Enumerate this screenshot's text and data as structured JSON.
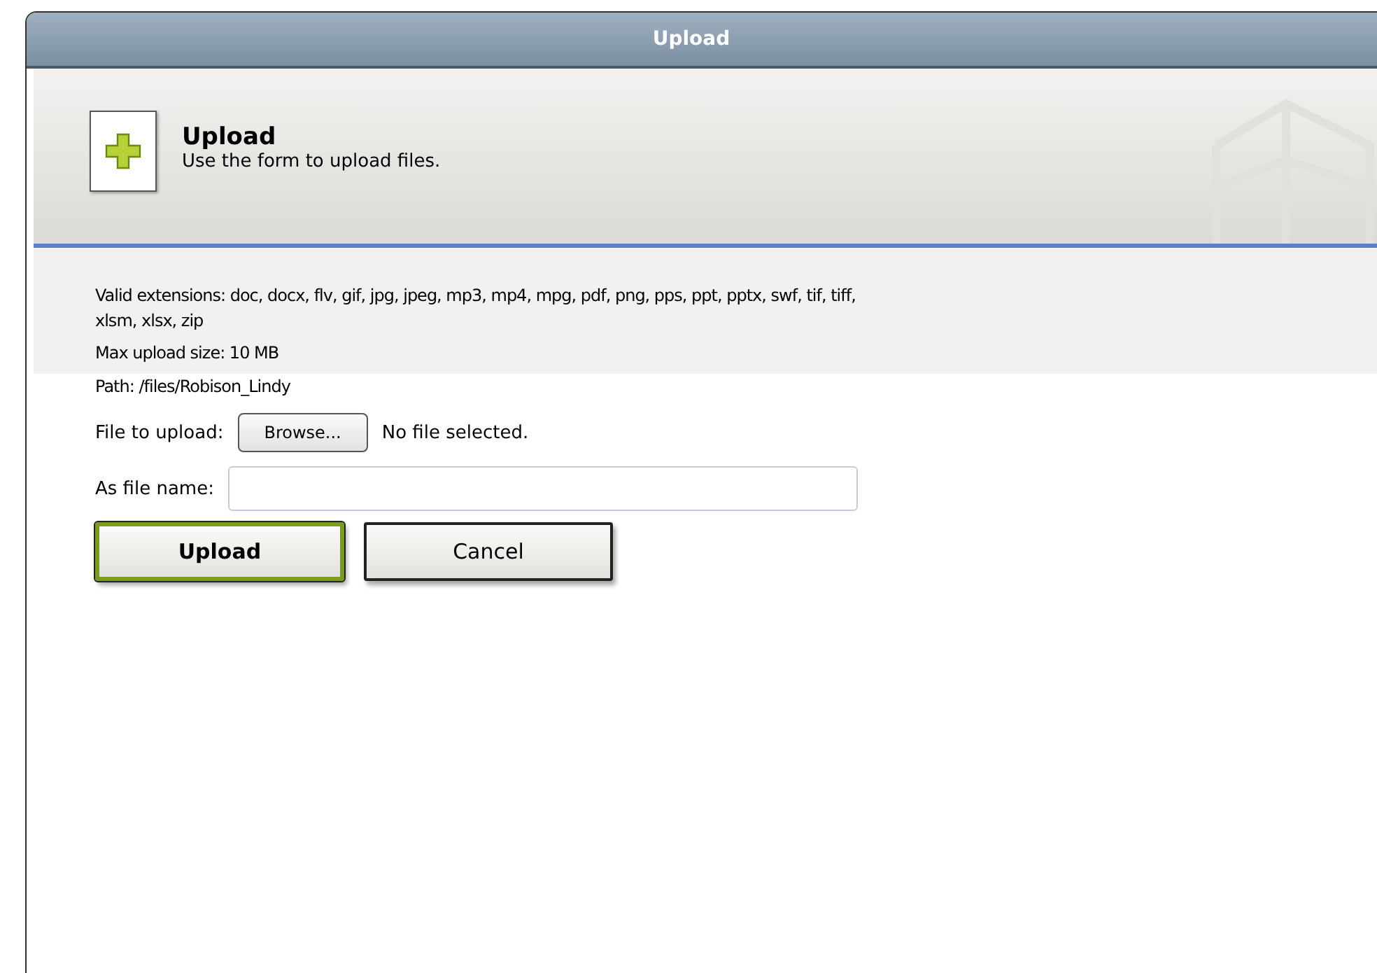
{
  "window": {
    "title": "Upload"
  },
  "header": {
    "title": "Upload",
    "subtitle": "Use the form to upload files."
  },
  "info": {
    "extensions_lines": [
      "Valid extensions: doc, docx, flv, gif, jpg, jpeg, mp3, mp4, mpg, pdf, png, pps, ppt, pptx, swf, tif, tiff,",
      "xlsm, xlsx, zip"
    ],
    "max_size": "Max upload size: 10 MB",
    "path": "Path: /files/Robison_Lindy"
  },
  "form": {
    "file_label": "File to upload:",
    "browse_button": "Browse...",
    "file_status": "No file selected.",
    "name_label": "As file name:"
  },
  "buttons": [
    {
      "label": "Upload",
      "kind": "primary"
    },
    {
      "label": "Cancel",
      "kind": "secondary"
    }
  ]
}
